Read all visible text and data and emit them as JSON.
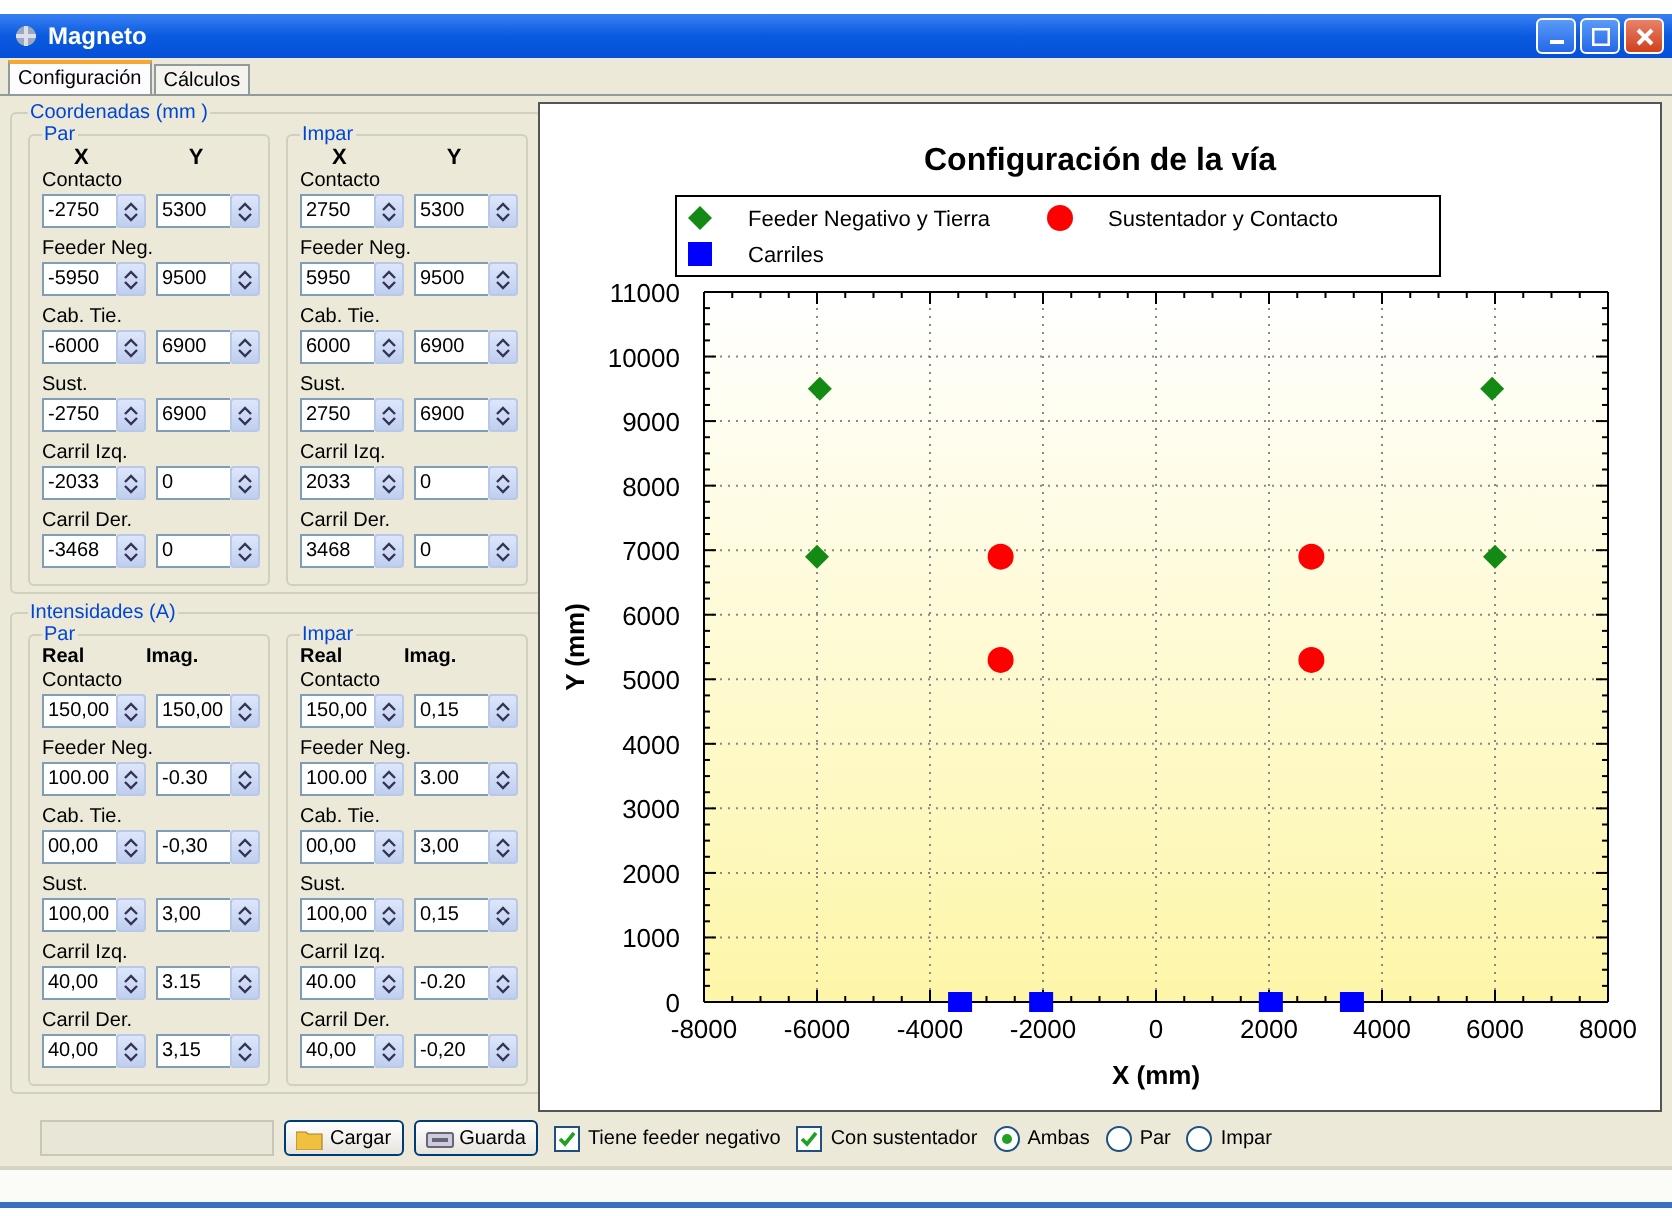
{
  "window": {
    "title": "Magneto"
  },
  "tabs": [
    {
      "label": "Configuración",
      "selected": true
    },
    {
      "label": "Cálculos",
      "selected": false
    }
  ],
  "panels": [
    {
      "title": "Coordenadas (mm )",
      "groups": [
        {
          "title": "Par",
          "headers": [
            "X",
            "Y"
          ],
          "rows": [
            {
              "label": "Contacto",
              "values": [
                "-2750",
                "5300"
              ]
            },
            {
              "label": "Feeder Neg.",
              "values": [
                "-5950",
                "9500"
              ]
            },
            {
              "label": "Cab. Tie.",
              "values": [
                "-6000",
                "6900"
              ]
            },
            {
              "label": "Sust.",
              "values": [
                "-2750",
                "6900"
              ]
            },
            {
              "label": "Carril Izq.",
              "values": [
                "-2033",
                "0"
              ]
            },
            {
              "label": "Carril Der.",
              "values": [
                "-3468",
                "0"
              ]
            }
          ]
        },
        {
          "title": "Impar",
          "headers": [
            "X",
            "Y"
          ],
          "rows": [
            {
              "label": "Contacto",
              "values": [
                "2750",
                "5300"
              ]
            },
            {
              "label": "Feeder Neg.",
              "values": [
                "5950",
                "9500"
              ]
            },
            {
              "label": "Cab. Tie.",
              "values": [
                "6000",
                "6900"
              ]
            },
            {
              "label": "Sust.",
              "values": [
                "2750",
                "6900"
              ]
            },
            {
              "label": "Carril Izq.",
              "values": [
                "2033",
                "0"
              ]
            },
            {
              "label": "Carril Der.",
              "values": [
                "3468",
                "0"
              ]
            }
          ]
        }
      ]
    },
    {
      "title": "Intensidades (A)",
      "groups": [
        {
          "title": "Par",
          "headers": [
            "Real",
            "Imag."
          ],
          "rows": [
            {
              "label": "Contacto",
              "values": [
                "150,00",
                "150,00"
              ]
            },
            {
              "label": "Feeder Neg.",
              "values": [
                "100.00",
                "-0.30"
              ]
            },
            {
              "label": "Cab. Tie.",
              "values": [
                "00,00",
                "-0,30"
              ]
            },
            {
              "label": "Sust.",
              "values": [
                "100,00",
                "3,00"
              ]
            },
            {
              "label": "Carril Izq.",
              "values": [
                "40,00",
                "3.15"
              ]
            },
            {
              "label": "Carril Der.",
              "values": [
                "40,00",
                "3,15"
              ]
            }
          ]
        },
        {
          "title": "Impar",
          "headers": [
            "Real",
            "Imag."
          ],
          "rows": [
            {
              "label": "Contacto",
              "values": [
                "150,00",
                "0,15"
              ]
            },
            {
              "label": "Feeder Neg.",
              "values": [
                "100.00",
                "3.00"
              ]
            },
            {
              "label": "Cab. Tie.",
              "values": [
                "00,00",
                "3,00"
              ]
            },
            {
              "label": "Sust.",
              "values": [
                "100,00",
                "0,15"
              ]
            },
            {
              "label": "Carril Izq.",
              "values": [
                "40.00",
                "-0.20"
              ]
            },
            {
              "label": "Carril Der.",
              "values": [
                "40,00",
                "-0,20"
              ]
            }
          ]
        }
      ]
    }
  ],
  "chart": {
    "chart_data": {
      "type": "scatter",
      "title": "Configuración de la vía",
      "xlabel": "X (mm)",
      "ylabel": "Y (mm)",
      "xlim": [
        -8000,
        8000
      ],
      "ylim": [
        0,
        11000
      ],
      "grid": true,
      "legend": true,
      "x": [
        -6000,
        -5950,
        -3468,
        -2750,
        -2750,
        -2033,
        2033,
        2750,
        2750,
        3468,
        5950,
        6000
      ],
      "xticks": [
        {
          "value": -8000,
          "label": "-8000"
        },
        {
          "value": -6000,
          "label": "-6000"
        },
        {
          "value": -4000,
          "label": "-4000"
        },
        {
          "value": -2000,
          "label": "-2000"
        },
        {
          "value": 0,
          "label": "0"
        },
        {
          "value": 2000,
          "label": "2000"
        },
        {
          "value": 4000,
          "label": "4000"
        },
        {
          "value": 6000,
          "label": "6000"
        },
        {
          "value": 8000,
          "label": "8000"
        }
      ],
      "yticks": [
        0,
        1000,
        2000,
        3000,
        4000,
        5000,
        6000,
        7000,
        8000,
        9000,
        10000,
        11000
      ],
      "series": [
        {
          "name": "Feeder Negativo y Tierra",
          "color": "#138a13",
          "values": [
            6900,
            9500,
            null,
            null,
            null,
            null,
            null,
            null,
            null,
            null,
            9500,
            6900
          ]
        },
        {
          "name": "Sustentador y Contacto",
          "color": "#ff0000",
          "values": [
            null,
            null,
            null,
            6900,
            5300,
            null,
            null,
            6900,
            5300,
            null,
            null,
            null
          ]
        },
        {
          "name": "Carriles",
          "color": "#0000ff",
          "values": [
            null,
            null,
            0,
            null,
            null,
            0,
            0,
            null,
            null,
            0,
            null,
            null
          ]
        }
      ]
    }
  },
  "buttons": [
    {
      "label": "Cargar",
      "kind": "folder"
    },
    {
      "label": "Guarda",
      "kind": "disk"
    }
  ],
  "checkboxes": [
    {
      "label": "Tiene feeder negativo",
      "checked": true
    },
    {
      "label": "Con sustentador",
      "checked": true
    }
  ],
  "radios": [
    {
      "label": "Ambas",
      "selected": true
    },
    {
      "label": "Par",
      "selected": false
    },
    {
      "label": "Impar",
      "selected": false
    }
  ]
}
